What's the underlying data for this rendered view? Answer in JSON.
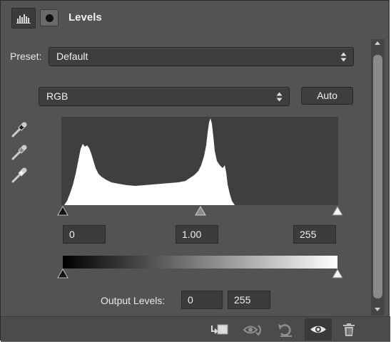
{
  "header": {
    "title": "Levels",
    "histogram_icon": "histogram-icon",
    "mask_icon": "mask-icon"
  },
  "preset": {
    "label": "Preset:",
    "value": "Default"
  },
  "channel": {
    "value": "RGB"
  },
  "auto_button": {
    "label": "Auto"
  },
  "eyedroppers": [
    "black-point-eyedropper-icon",
    "gray-point-eyedropper-icon",
    "white-point-eyedropper-icon"
  ],
  "input_levels": {
    "black": "0",
    "gamma": "1.00",
    "white": "255"
  },
  "output_levels": {
    "label": "Output Levels:",
    "black": "0",
    "white": "255"
  },
  "footer_icons": [
    "clip-to-layer-icon",
    "view-previous-state-icon",
    "reset-icon",
    "visibility-eye-icon",
    "trash-icon"
  ],
  "colors": {
    "panel": "#535353",
    "field": "#3e3e3e",
    "histogram_bg": "#3f3f3f",
    "histogram_fill": "#ffffff"
  }
}
